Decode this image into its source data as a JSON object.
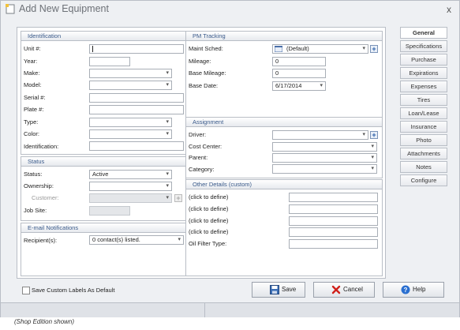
{
  "window": {
    "title": "Add New Equipment",
    "close_glyph": "x"
  },
  "identification": {
    "header": "Identification",
    "unit_label": "Unit #:",
    "year_label": "Year:",
    "make_label": "Make:",
    "model_label": "Model:",
    "serial_label": "Serial #:",
    "plate_label": "Plate #:",
    "type_label": "Type:",
    "color_label": "Color:",
    "identification_label": "Identification:"
  },
  "status": {
    "header": "Status",
    "status_label": "Status:",
    "status_value": "Active",
    "ownership_label": "Ownership:",
    "customer_label": "Customer:",
    "jobsite_label": "Job Site:"
  },
  "email": {
    "header": "E-mail Notifications",
    "recipients_label": "Recipient(s):",
    "recipients_value": "0 contact(s) listed."
  },
  "pm": {
    "header": "PM Tracking",
    "maint_sched_label": "Maint Sched:",
    "maint_sched_value": "(Default)",
    "mileage_label": "Mileage:",
    "mileage_value": "0",
    "base_mileage_label": "Base Mileage:",
    "base_mileage_value": "0",
    "base_date_label": "Base Date:",
    "base_date_value": "6/17/2014"
  },
  "assignment": {
    "header": "Assignment",
    "driver_label": "Driver:",
    "cost_center_label": "Cost Center:",
    "parent_label": "Parent:",
    "category_label": "Category:"
  },
  "other": {
    "header": "Other Details (custom)",
    "items": [
      "(click to define)",
      "(click to define)",
      "(click to define)",
      "(click to define)",
      "Oil Filter Type:"
    ]
  },
  "tabs": [
    "General",
    "Specifications",
    "Purchase",
    "Expirations",
    "Expenses",
    "Tires",
    "Loan/Lease",
    "Insurance",
    "Photo",
    "Attachments",
    "Notes",
    "Configure"
  ],
  "footer": {
    "save_labels_checkbox": "Save Custom Labels As Default",
    "save": "Save",
    "cancel": "Cancel",
    "help": "Help"
  },
  "caption": "(Shop Edition shown)",
  "colors": {
    "accent": "#3a5a8a",
    "border": "#b9bec6",
    "cancel_icon": "#d0201a",
    "help_icon": "#2a6fd0",
    "save_icon": "#3a6db5"
  }
}
